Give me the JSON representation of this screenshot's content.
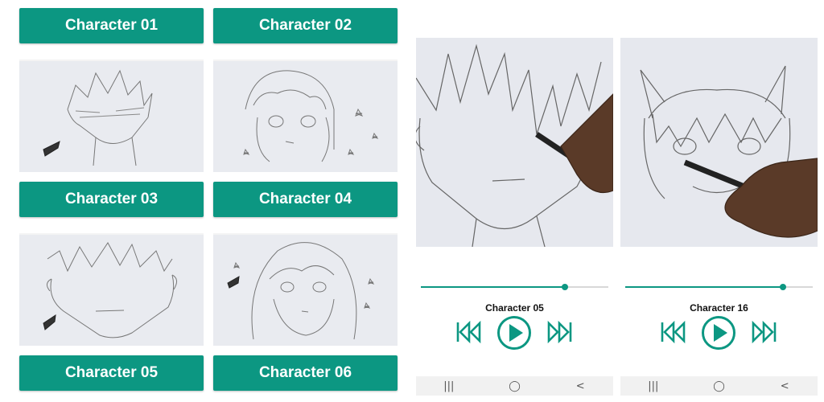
{
  "grid": {
    "cards": [
      {
        "label": "Character 01"
      },
      {
        "label": "Character 02"
      },
      {
        "label": "Character 03"
      },
      {
        "label": "Character 04"
      },
      {
        "label": "Character 05"
      },
      {
        "label": "Character 06"
      }
    ]
  },
  "players": [
    {
      "title": "Character 05",
      "progress": 0.77
    },
    {
      "title": "Character 16",
      "progress": 0.84
    }
  ],
  "navbar": {
    "recents": "|||",
    "home": "◯",
    "back": "<"
  },
  "colors": {
    "accent": "#0c9782",
    "thumb_bg": "#e9ebf0"
  },
  "icons": {
    "previous": "skip-previous-icon",
    "play": "play-icon",
    "next": "skip-next-icon"
  }
}
